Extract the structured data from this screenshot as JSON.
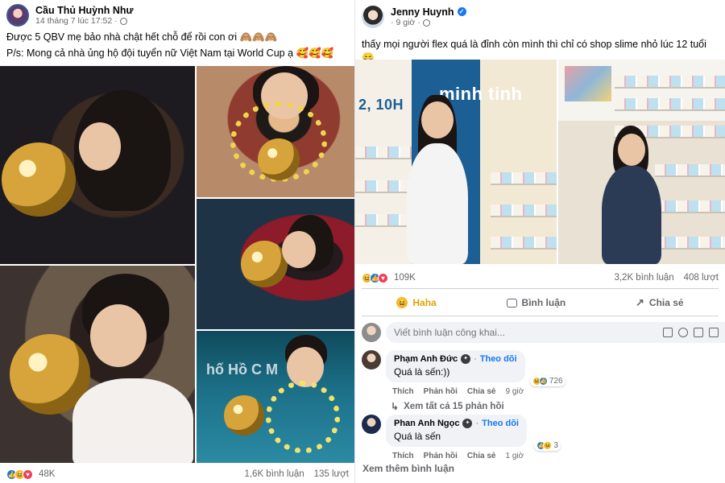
{
  "left_post": {
    "author": "Cầu Thủ Huỳnh Như",
    "time": "14 tháng 7 lúc 17:52",
    "time_separator": "·",
    "text_line_1": "Được 5 QBV mẹ bảo nhà chật hết chỗ để rồi con ơi 🙈🙈🙈",
    "text_line_2": "P/s: Mong cả nhà ủng hộ đội tuyển nữ Việt Nam tại World Cup ạ 🥰🥰🥰",
    "stage_text": "hố Hồ C  M",
    "reaction_count": "48K",
    "comments": "1,6K bình luận",
    "shares": "135 lượt"
  },
  "right_post": {
    "author": "Jenny Huynh",
    "time": "9 giờ",
    "time_separator": "·",
    "text": "thấy mọi người flex quá là đỉnh còn mình thì chỉ có shop slime nhỏ lúc 12 tuổi 😄",
    "sign_text_1": "minh tinh",
    "sign_text_2": "2, 10H",
    "reaction_count": "109K",
    "comments": "3,2K bình luận",
    "shares": "408 lượt",
    "actions": {
      "haha": "Haha",
      "comment": "Bình luận",
      "share": "Chia sẻ"
    },
    "comment_placeholder": "Viết bình luận công khai...",
    "comment_list": [
      {
        "name": "Phạm Anh Đức",
        "dot": "·",
        "follow": "Theo dõi",
        "text": "Quá là sến:))",
        "reaction_count": "726",
        "like": "Thích",
        "reply": "Phản hồi",
        "share": "Chia sẻ",
        "time": "9 giờ",
        "view_replies": "Xem tất cả 15 phản hồi"
      },
      {
        "name": "Phan Anh Ngọc",
        "dot": "·",
        "follow": "Theo dõi",
        "text": "Quá là sến",
        "reaction_count": "3",
        "like": "Thích",
        "reply": "Phản hồi",
        "share": "Chia sẻ",
        "time": "1 giờ"
      }
    ],
    "more_comments": "Xem thêm bình luận"
  },
  "colors": {
    "facebook_blue": "#1877f2",
    "secondary_text": "#65676b",
    "haha_yellow": "#f7b928",
    "love_red": "#f33e58"
  },
  "icons": [
    "globe-icon",
    "verified-badge-icon",
    "like-reaction-icon",
    "haha-reaction-icon",
    "love-reaction-icon",
    "comment-icon",
    "share-icon",
    "emoji-icon",
    "camera-icon",
    "gif-icon",
    "sticker-icon",
    "reply-arrow-icon"
  ]
}
